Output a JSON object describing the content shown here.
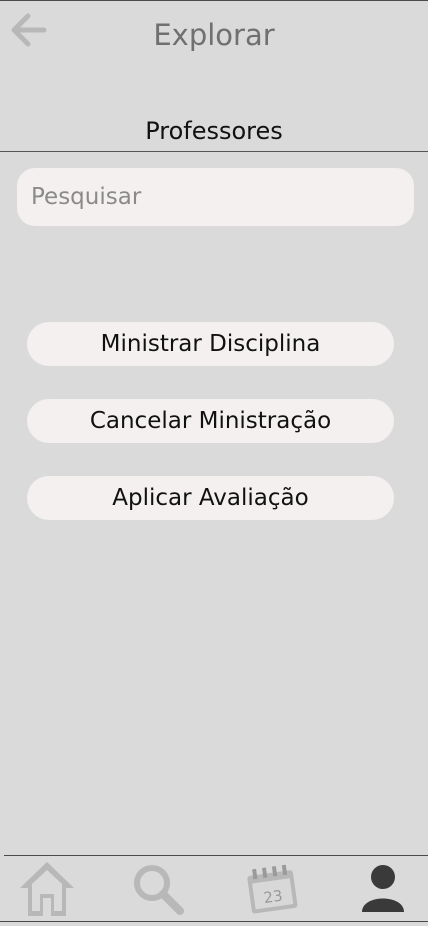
{
  "header": {
    "title": "Explorar"
  },
  "section": {
    "title": "Professores"
  },
  "search": {
    "placeholder": "Pesquisar"
  },
  "actions": [
    {
      "label": "Ministrar Disciplina"
    },
    {
      "label": "Cancelar Ministração"
    },
    {
      "label": "Aplicar Avaliação"
    }
  ],
  "bottom_nav": {
    "items": [
      {
        "icon": "home-icon",
        "active": false
      },
      {
        "icon": "search-icon",
        "active": false
      },
      {
        "icon": "calendar-icon",
        "active": false,
        "calendar_day": "23"
      },
      {
        "icon": "user-profile-icon",
        "active": true
      }
    ]
  },
  "colors": {
    "background": "#dadada",
    "button_bg": "#f4f0f0",
    "inactive_icon": "#b8b8b8",
    "active_icon": "#3a3a3a",
    "title_text": "#707070"
  }
}
